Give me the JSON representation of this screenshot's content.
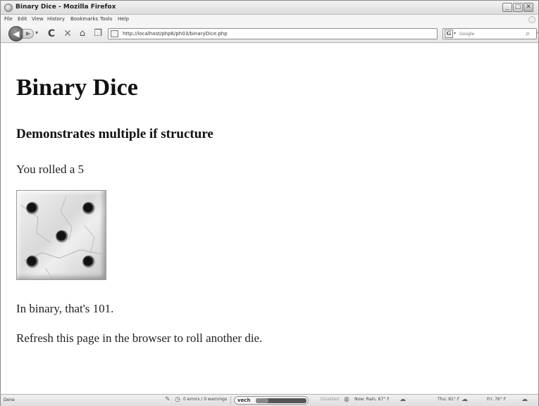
{
  "window": {
    "title": "Binary Dice - Mozilla Firefox",
    "controls": {
      "minimize": "_",
      "maximize": "□",
      "close": "✕"
    }
  },
  "menu": {
    "items": [
      "File",
      "Edit",
      "View",
      "History",
      "Bookmarks",
      "Tools",
      "Help"
    ]
  },
  "toolbar": {
    "url": "http://localhost/php6/ph03/binaryDice.php",
    "search_placeholder": "Google",
    "search_engine_letter": "G"
  },
  "page": {
    "heading": "Binary Dice",
    "subheading": "Demonstrates multiple if structure",
    "rolled_text": "You rolled a 5",
    "die": {
      "value": 5,
      "alt": "die 5"
    },
    "binary_text": "In binary, that's 101.",
    "refresh_text": "Refresh this page in the browser to roll another die."
  },
  "status": {
    "text": "Done",
    "errors": "0 errors / 0 warnings",
    "vech_label": "vech",
    "vech_level": 0.25,
    "disabled": "Disabled",
    "weather_now": "Now: Rain, 67° F",
    "weather_thu": "Thu: 81° F",
    "weather_fri": "Fri: 76° F"
  },
  "icons": {
    "back": "back-arrow-icon",
    "forward": "forward-arrow-icon",
    "reload": "reload-icon",
    "stop": "stop-icon",
    "home": "home-icon",
    "bookmark_star": "star-icon",
    "search": "magnifier-icon"
  }
}
